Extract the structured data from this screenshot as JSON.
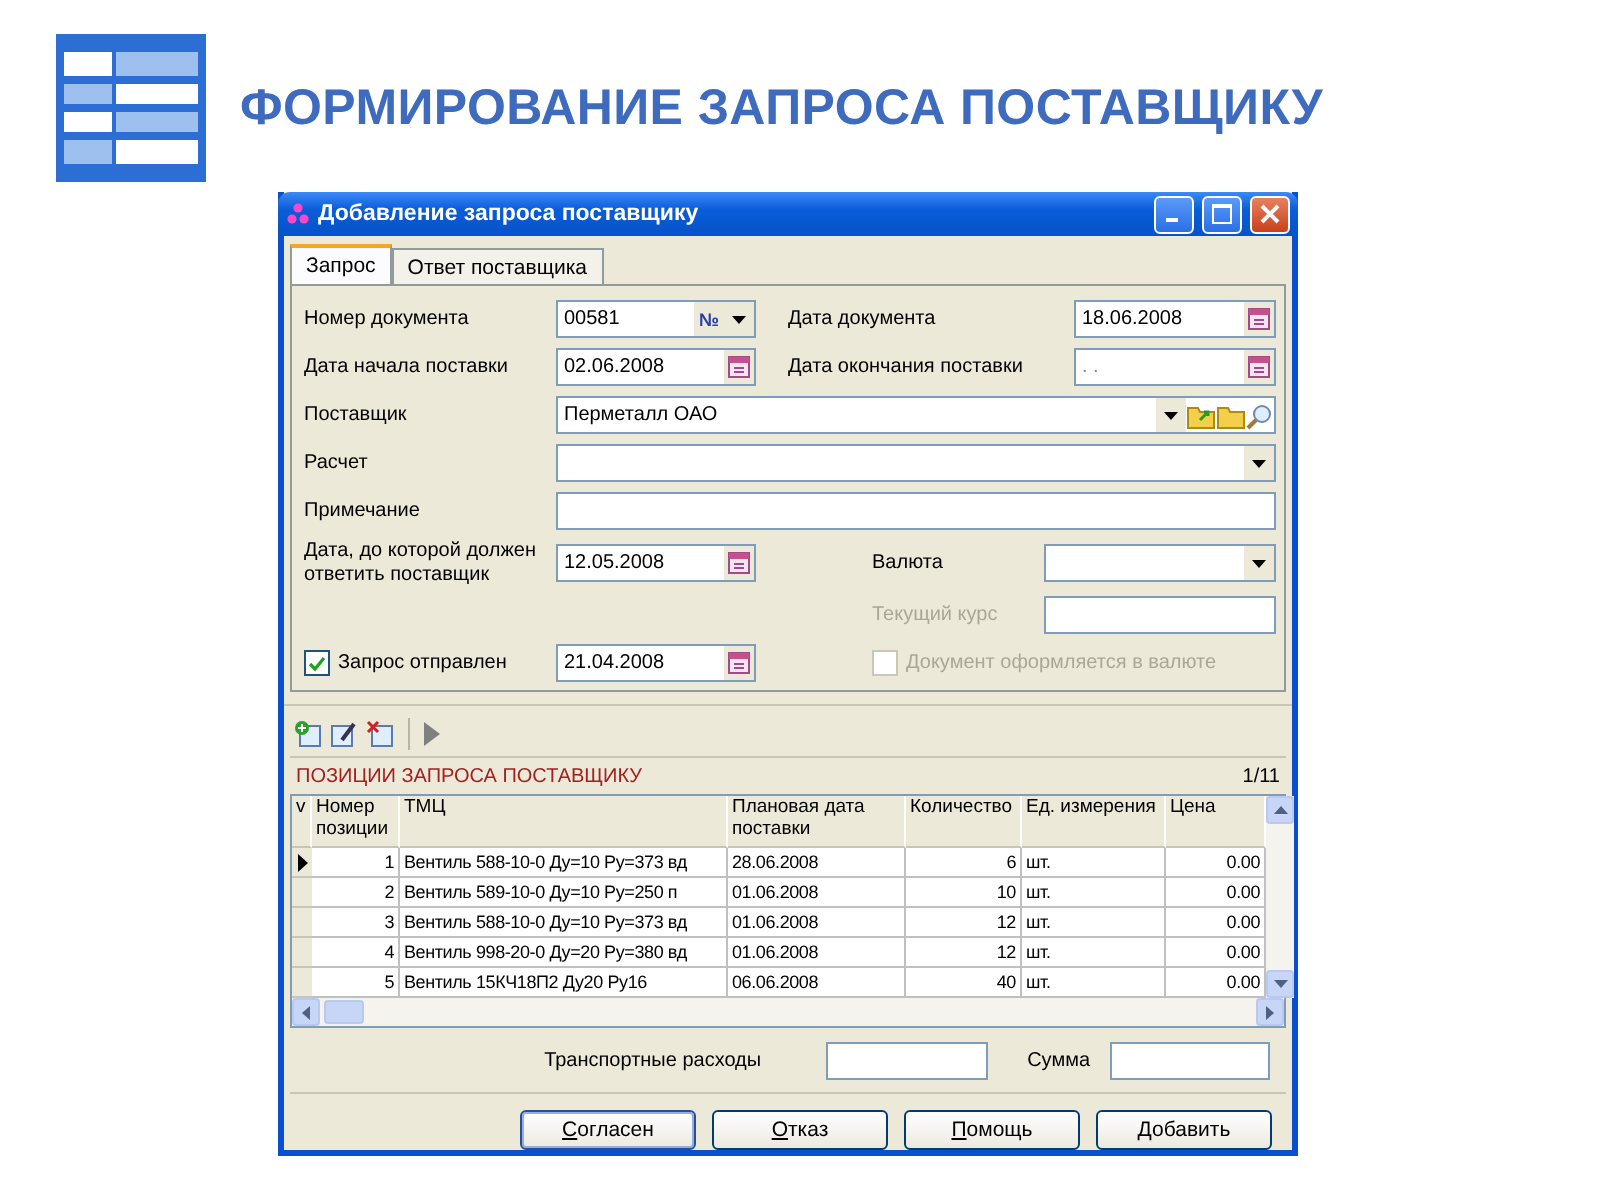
{
  "slide": {
    "title": "ФОРМИРОВАНИЕ ЗАПРОСА ПОСТАВЩИКУ"
  },
  "window": {
    "title": "Добавление запроса поставщику"
  },
  "tabs": [
    {
      "label": "Запрос",
      "selected": true
    },
    {
      "label": "Ответ поставщика",
      "selected": false
    }
  ],
  "form": {
    "doc_number": {
      "label": "Номер документа",
      "value": "00581",
      "button": "№"
    },
    "doc_date": {
      "label": "Дата документа",
      "value": "18.06.2008"
    },
    "start_date": {
      "label": "Дата начала поставки",
      "value": "02.06.2008"
    },
    "end_date": {
      "label": "Дата окончания поставки",
      "placeholder": ". ."
    },
    "supplier": {
      "label": "Поставщик",
      "value": "Перметалл ОАО"
    },
    "payment": {
      "label": "Расчет"
    },
    "note": {
      "label": "Примечание"
    },
    "reply_by": {
      "label": "Дата, до которой должен ответить поставщик",
      "value": "12.05.2008"
    },
    "currency": {
      "label": "Валюта"
    },
    "rate": {
      "label": "Текущий курс",
      "disabled": true
    },
    "sent": {
      "label": "Запрос отправлен",
      "checked": true,
      "value": "21.04.2008"
    },
    "in_currency": {
      "label": "Документ оформляется в валюте",
      "checked": false,
      "disabled": true
    }
  },
  "table": {
    "title": "ПОЗИЦИИ ЗАПРОСА ПОСТАВЩИКУ",
    "counter": "1/11",
    "columns": [
      "v",
      "Номер позиции",
      "ТМЦ",
      "Плановая дата поставки",
      "Количество",
      "Ед. измерения",
      "Цена"
    ],
    "rows": [
      {
        "selected": true,
        "cells": [
          "",
          "1",
          "Вентиль 588-10-0 Ду=10 Ру=373 вд",
          "28.06.2008",
          "6",
          "шт.",
          "0.00"
        ]
      },
      {
        "selected": false,
        "cells": [
          "",
          "2",
          "Вентиль 589-10-0 Ду=10 Ру=250 п",
          "01.06.2008",
          "10",
          "шт.",
          "0.00"
        ]
      },
      {
        "selected": false,
        "cells": [
          "",
          "3",
          "Вентиль 588-10-0 Ду=10 Ру=373 вд",
          "01.06.2008",
          "12",
          "шт.",
          "0.00"
        ]
      },
      {
        "selected": false,
        "cells": [
          "",
          "4",
          "Вентиль 998-20-0 Ду=20 Ру=380 вд",
          "01.06.2008",
          "12",
          "шт.",
          "0.00"
        ]
      },
      {
        "selected": false,
        "cells": [
          "",
          "5",
          "Вентиль 15КЧ18П2 Ду20 Ру16",
          "06.06.2008",
          "40",
          "шт.",
          "0.00"
        ]
      }
    ]
  },
  "totals": {
    "transport_label": "Транспортные расходы",
    "sum_label": "Сумма"
  },
  "buttons": [
    {
      "label": "Согласен",
      "default": true
    },
    {
      "label": "Отказ",
      "default": false
    },
    {
      "label": "Помощь",
      "default": false
    },
    {
      "label": "Добавить",
      "default": false
    }
  ]
}
